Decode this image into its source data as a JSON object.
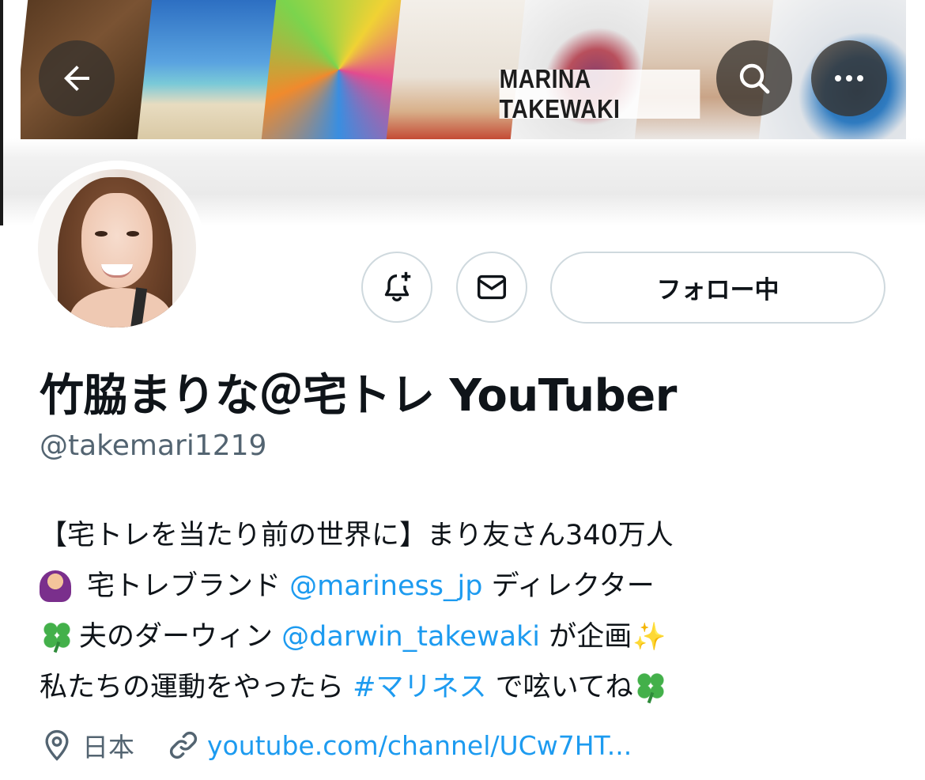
{
  "banner": {
    "title": "MARINA TAKEWAKI"
  },
  "profile": {
    "display_name": "竹脇まりな＠宅トレ YouTuber",
    "handle": "@takemari1219",
    "follow_button_label": "フォロー中"
  },
  "bio": {
    "line1": "【宅トレを当たり前の世界に】まり友さん340万人",
    "line2_text": "宅トレブランド",
    "line2_mention": "@mariness_jp",
    "line2_suffix": "ディレクター",
    "line3_text": "夫のダーウィン",
    "line3_mention": "@darwin_takewaki",
    "line3_suffix": "が企画",
    "line4_text": "私たちの運動をやったら",
    "line4_hashtag": "#マリネス",
    "line4_suffix": "で呟いてね"
  },
  "meta": {
    "location": "日本",
    "website": "youtube.com/channel/UCw7HT..."
  },
  "icons": {
    "back": "back-arrow-icon",
    "search": "search-icon",
    "more": "more-icon",
    "notify": "bell-plus-icon",
    "message": "envelope-icon",
    "location": "location-pin-icon",
    "link": "link-icon"
  },
  "colors": {
    "link": "#1d9bf0",
    "secondary_text": "#536471",
    "border": "#cfd9de"
  }
}
